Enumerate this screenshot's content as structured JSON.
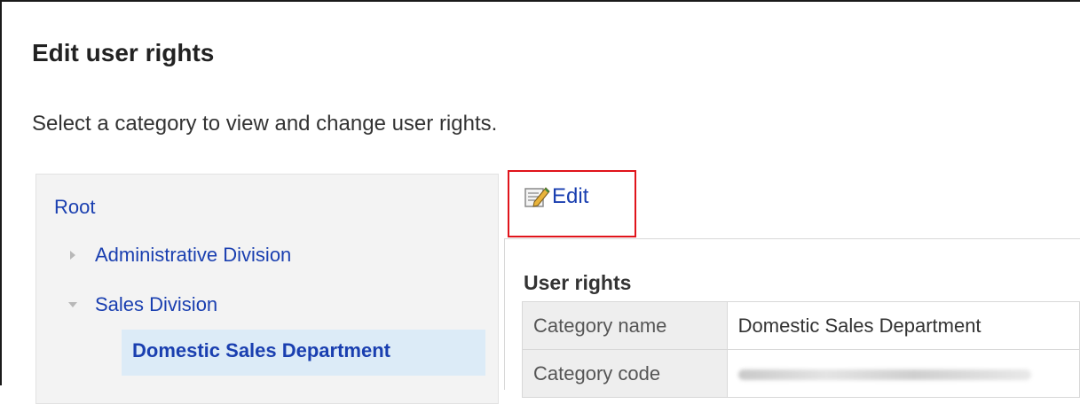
{
  "page": {
    "title": "Edit user rights",
    "description": "Select a category to view and change user rights."
  },
  "tree": {
    "root_label": "Root",
    "items": [
      {
        "label": "Administrative Division",
        "state": "collapsed"
      },
      {
        "label": "Sales Division",
        "state": "expanded"
      }
    ],
    "selected_label": "Domestic Sales Department"
  },
  "toolbar": {
    "edit_label": "Edit",
    "edit_icon": "edit-icon"
  },
  "rights": {
    "section_title": "User rights",
    "rows": [
      {
        "label": "Category name",
        "value": "Domestic Sales Department"
      },
      {
        "label": "Category code",
        "value": ""
      }
    ]
  },
  "colors": {
    "link": "#1a3fb0",
    "highlight_border": "#e0141b",
    "selected_bg": "#dcebf7"
  }
}
